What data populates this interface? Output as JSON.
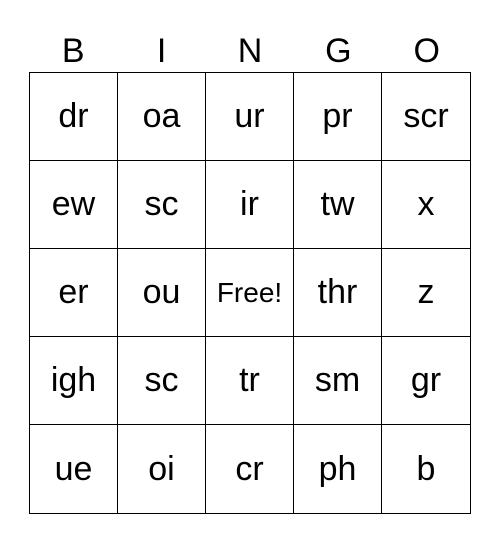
{
  "header": [
    "B",
    "I",
    "N",
    "G",
    "O"
  ],
  "cells": [
    [
      "dr",
      "oa",
      "ur",
      "pr",
      "scr"
    ],
    [
      "ew",
      "sc",
      "ir",
      "tw",
      "x"
    ],
    [
      "er",
      "ou",
      "Free!",
      "thr",
      "z"
    ],
    [
      "igh",
      "sc",
      "tr",
      "sm",
      "gr"
    ],
    [
      "ue",
      "oi",
      "cr",
      "ph",
      "b"
    ]
  ]
}
